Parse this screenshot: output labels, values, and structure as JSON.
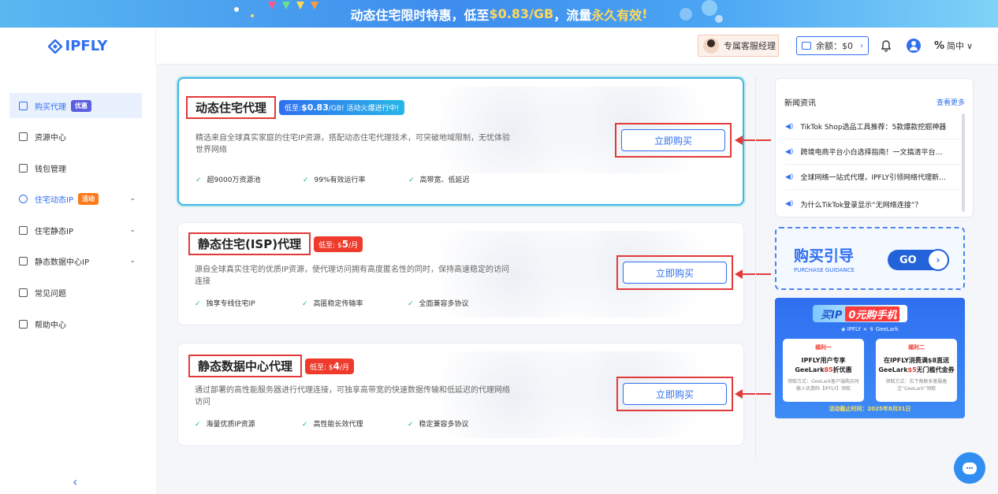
{
  "banner": {
    "prefix": "动态住宅限时特惠，低至",
    "price": "$0.83/GB",
    "middle": "，流量",
    "highlight": "永久有效",
    "suffix": "!"
  },
  "logo": {
    "text": "IPFLY"
  },
  "header": {
    "manager": "专属客服经理",
    "balance": "余额：$0",
    "lang": "简中"
  },
  "sidebar": {
    "items": [
      {
        "label": "购买代理",
        "tag": "优惠"
      },
      {
        "label": "资源中心"
      },
      {
        "label": "钱包管理"
      },
      {
        "label": "住宅动态IP",
        "tag": "活动"
      },
      {
        "label": "住宅静态IP"
      },
      {
        "label": "静态数据中心IP"
      },
      {
        "label": "常见问题"
      },
      {
        "label": "帮助中心"
      }
    ]
  },
  "products": [
    {
      "title": "动态住宅代理",
      "badge_pre": "低至:",
      "badge_price": "$0.83",
      "badge_post": "/GB! 活动火爆进行中!",
      "desc": "精选来自全球真实家庭的住宅IP资源，搭配动态住宅代理技术，可突破地域限制，无忧体验世界网络",
      "features": [
        "超9000万资源池",
        "99%有效运行率",
        "高带宽、低延迟"
      ],
      "buy": "立即购买"
    },
    {
      "title": "静态住宅(ISP)代理",
      "badge_pre": "低至: $",
      "badge_price": "5",
      "badge_post": "/月",
      "desc": "源自全球真实住宅的优质IP资源，使代理访问拥有高度匿名性的同时，保持高速稳定的访问连接",
      "features": [
        "独享专线住宅IP",
        "高匿稳定传输率",
        "全面兼容多协议"
      ],
      "buy": "立即购买"
    },
    {
      "title": "静态数据中心代理",
      "badge_pre": "低至: $",
      "badge_price": "4",
      "badge_post": "/月",
      "desc": "通过部署的高性能服务器进行代理连接，可独享高带宽的快速数据传输和低延迟的代理网络访问",
      "features": [
        "海量优质IP资源",
        "高性能长效代理",
        "稳定兼容多协议"
      ],
      "buy": "立即购买"
    }
  ],
  "news": {
    "title": "新闻资讯",
    "more": "查看更多",
    "items": [
      "TikTok Shop选品工具推荐：5款爆款挖掘神器",
      "跨境电商平台小白选择指南！一文搞清平台…",
      "全球网络一站式代理，IPFLY引领网络代理新…",
      "为什么TikTok登录显示“无网络连接”？"
    ]
  },
  "guide": {
    "title": "购买引导",
    "subtitle": "PURCHASE GUIDANCE",
    "go": "GO"
  },
  "promo": {
    "head": "买IP",
    "head_hl": "0元购手机",
    "brands": "◈ IPFLY × ↯ GeeLark",
    "card1": {
      "welfare": "福利一",
      "l1": "IPFLY用户专享",
      "l2a": "GeeLark",
      "l2b": "85",
      "l2c": "折优惠",
      "small": "领取方式：GeeLark客户端购买时输入优惠码【IPFLY】领取"
    },
    "card2": {
      "welfare": "福利二",
      "l1": "在IPFLY消费满$8直送",
      "l2a": "GeeLark",
      "l2b": "$5",
      "l2c": "无门槛代金券",
      "small": "领取方式：右下角联系客服备注“GeeLark”领取"
    },
    "foot": "活动截止时间：2025年8月31日"
  },
  "colors": {
    "accent": "#2f6ff0",
    "highlight_border": "#e23a3a",
    "check": "#12b886"
  }
}
